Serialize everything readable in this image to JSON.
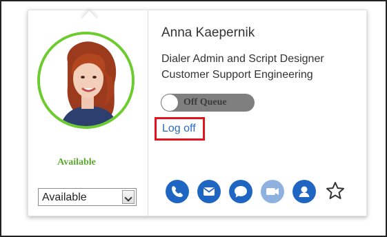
{
  "contact": {
    "name": "Anna Kaepernik",
    "title": "Dialer Admin and Script Designer",
    "department": "Customer Support Engineering"
  },
  "presence": {
    "status_label": "Available",
    "status_select_value": "Available",
    "ring_color": "#6ccc2e",
    "status_color": "#5aa92b"
  },
  "queue": {
    "label": "Off Queue",
    "state": "off"
  },
  "logoff": {
    "label": "Log off",
    "highlight_color": "#e2131e",
    "link_color": "#2e6bbb"
  },
  "actions": [
    {
      "icon": "phone-icon",
      "enabled": true
    },
    {
      "icon": "mail-icon",
      "enabled": true
    },
    {
      "icon": "chat-icon",
      "enabled": true
    },
    {
      "icon": "video-icon",
      "enabled": false
    },
    {
      "icon": "profile-icon",
      "enabled": true
    },
    {
      "icon": "star-icon",
      "enabled": true
    }
  ],
  "colors": {
    "accent": "#1f66c2",
    "disabled_accent": "#8fb1e0"
  }
}
